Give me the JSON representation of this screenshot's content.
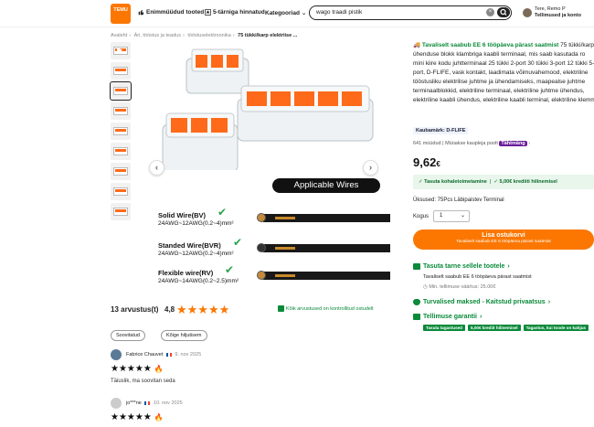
{
  "header": {
    "logo_text": "TEMU",
    "nav": [
      {
        "label": "Enimmüüdud tooted",
        "icon": "thumbs-up-icon"
      },
      {
        "label": "5-tärniga hinnatud",
        "icon": "star-badge-icon"
      },
      {
        "label": "Kategooriad",
        "icon": "chevron-down-icon"
      }
    ],
    "search_value": "wago traadi pistik",
    "user_name": "Tere, Remo P",
    "user_sub": "Tellimused ja konto"
  },
  "breadcrumb": [
    "Avaleht",
    "Äri, tööstus ja teadus",
    "tööstuselektroonika",
    "75 tükki/karp elektriise ..."
  ],
  "image": {
    "overlay_label": "Applicable Wires",
    "wires": [
      {
        "type": "Solid Wire(BV)",
        "spec": "24AWG~12AWG(0.2~4)mm²"
      },
      {
        "type": "Standed Wire(BVR)",
        "spec": "24AWG~12AWG(0.2~4)mm²"
      },
      {
        "type": "Flexible wire(RV)",
        "spec": "24AWG~14AWG(0.2~2.5)mm²"
      }
    ]
  },
  "reviews": {
    "count_label": "13 arvustus(t)",
    "score": "4,8",
    "stars": "★★★★★",
    "verified": "Kõik arvustused on kontrollitud ostudelt",
    "filters": [
      "Soovitatud",
      "Kõige hiljutisem"
    ],
    "items": [
      {
        "name": "Fabrice Chauvet",
        "date": "9. nov 2025",
        "stars": "★★★★★",
        "text": "Täiuslik, ma soovitan seda"
      },
      {
        "name": "jo***ne",
        "date": "10. nov 2025",
        "stars": "★★★★★",
        "text": ""
      }
    ]
  },
  "product": {
    "description_lead": "Tavaliselt saabub EE 6 tööpäeva pärast saatmist",
    "description": "75 tükki/karp ühenduse blokk klambriga kaabli terminaal, mis saab kasutada ro mini kiire kodu juhtterminaal 25 tükki 2-port 30 tükki 3-port 12 tükki 5-port, D-FLIFE, vask kontakt, laadimata võimuvahemood, elektriline tööstusliku elektrilise juhtme ja ühendamiseks, maapealse juhtme terminaalblokkid, elektriline terminaal, elektriline juhtme ühendus, elektriline kaabli ühendus, elektriline kaabli terminal, elektriline klemm",
    "brand": "Kaubamärk: D-FLIFE",
    "sold": "641 müüdud | Müüakse kaupleja poolt",
    "ad_badge": "Tähtmäng",
    "price_main": "9,62",
    "price_currency": "€",
    "ship_free": "Tasuta kohaletoimetamine",
    "credit": "5,00€ krediiti hilinemisel",
    "variant": "Üksused: 75Pcs Läbipaistev Terminal",
    "qty_label": "Kogus",
    "qty_value": "1",
    "cart_label": "Lisa ostukorvi",
    "cart_sub": "Tavaliselt saabub EE 6 tööpäeva pärast saatmist"
  },
  "sections": {
    "ship_title": "Tasuta tarne sellele tootele",
    "ship_line": "Tavaliselt saabub EE 6 tööpäeva pärast saatmist",
    "ship_min": "Min. tellimuse väärtus: 25.00€",
    "pay_title": "Turvalised maksed - Kaitstud privaatsus",
    "guarantee_title": "Tellimuse garantii",
    "tags": [
      "Tasuta tagastused",
      "5,00€ krediit hilinemisel",
      "Tagastus, kui toode on kahjus"
    ]
  },
  "colors": {
    "accent": "#fb7701",
    "green": "#0a8a3a"
  }
}
